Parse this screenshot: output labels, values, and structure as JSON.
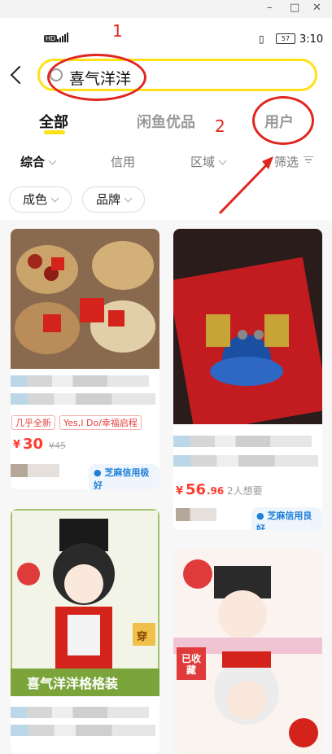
{
  "status": {
    "time": "3:10",
    "battery": "57",
    "net": "HD 4G"
  },
  "search": {
    "query": "喜气洋洋"
  },
  "tabs": [
    {
      "label": "全部"
    },
    {
      "label": "闲鱼优品"
    },
    {
      "label": "用户"
    }
  ],
  "filters": [
    {
      "label": "综合"
    },
    {
      "label": "信用"
    },
    {
      "label": "区域"
    },
    {
      "label": "筛选"
    }
  ],
  "chips": [
    {
      "label": "成色"
    },
    {
      "label": "品牌"
    }
  ],
  "annotations": {
    "n1": "1",
    "n2": "2"
  },
  "items": [
    {
      "tags": [
        "几乎全新",
        "Yes,I Do/幸福启程"
      ],
      "price_symbol": "¥",
      "price": "30",
      "original": "¥45",
      "credit": "芝麻信用极好"
    },
    {
      "price_symbol": "¥",
      "price": "56",
      "price_decimal": ".96",
      "want": "2人想要",
      "credit": "芝麻信用良好"
    },
    {
      "image_text": "喜气洋洋格格装",
      "badge": "穿"
    },
    {
      "badge": "已收藏"
    }
  ],
  "colors": {
    "accent_yellow": "#ffe11a",
    "price_red": "#ff3b30",
    "annotation_red": "#e0261f",
    "credit_blue": "#1d7fd8"
  }
}
